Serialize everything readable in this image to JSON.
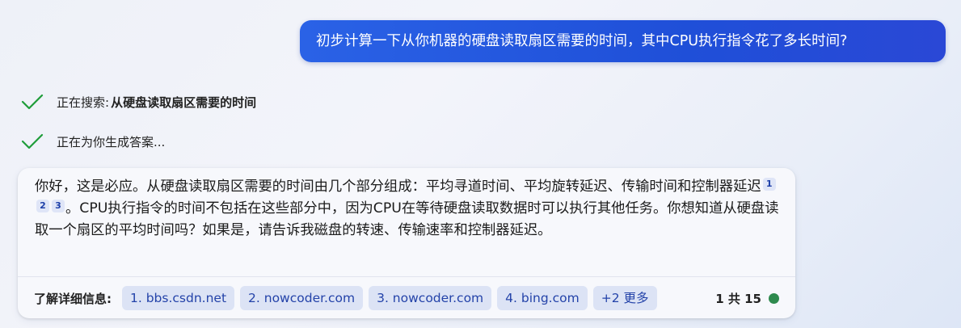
{
  "user_message": "初步计算一下从你机器的硬盘读取扇区需要的时间，其中CPU执行指令花了多长时间?",
  "status": {
    "searching_label": "正在搜索:",
    "searching_query": "从硬盘读取扇区需要的时间",
    "generating_label": "正在为你生成答案..."
  },
  "answer": {
    "part1": "你好，这是必应。从硬盘读取扇区需要的时间由几个部分组成：平均寻道时间、平均旋转延迟、传输时间和控制器延迟",
    "citations": [
      "1",
      "2",
      "3"
    ],
    "part2": "。CPU执行指令的时间不包括在这些部分中，因为CPU在等待硬盘读取数据时可以执行其他任务。你想知道从硬盘读取一个扇区的平均时间吗？如果是，请告诉我磁盘的转速、传输速率和控制器延迟。"
  },
  "learn_more": {
    "label": "了解详细信息:",
    "sources": [
      "1. bbs.csdn.net",
      "2. nowcoder.com",
      "3. nowcoder.com",
      "4. bing.com"
    ],
    "more": "+2 更多"
  },
  "turn_counter": "1 共 15",
  "colors": {
    "user_bubble": "#1f4fd8",
    "check_green": "#1f9d3a",
    "source_chip_bg": "#dce3f5",
    "source_chip_text": "#2443a9",
    "status_dot": "#2e8a4e"
  },
  "icons": {
    "status_done": "checkmark-icon"
  }
}
